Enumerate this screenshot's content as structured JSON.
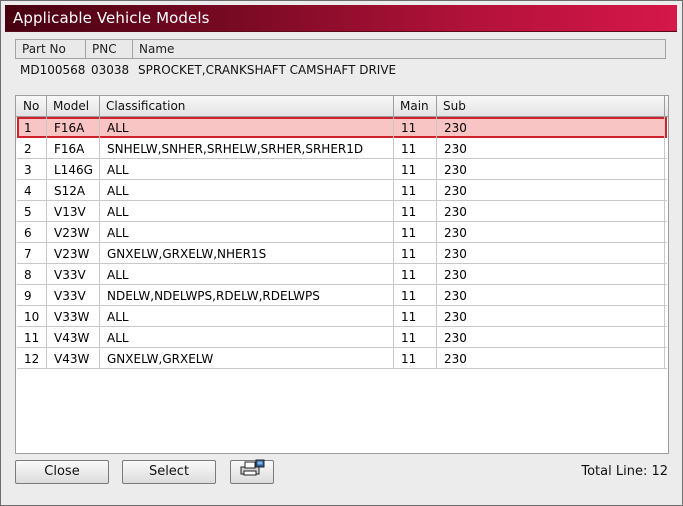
{
  "window": {
    "title": "Applicable Vehicle Models"
  },
  "part_info": {
    "headers": {
      "part_no": "Part No",
      "pnc": "PNC",
      "name": "Name"
    },
    "values": {
      "part_no": "MD100568",
      "pnc": "03038",
      "name": "SPROCKET,CRANKSHAFT CAMSHAFT DRIVE"
    }
  },
  "table": {
    "headers": {
      "no": "No",
      "model": "Model",
      "classification": "Classification",
      "main": "Main",
      "sub": "Sub"
    },
    "rows": [
      {
        "no": "1",
        "model": "F16A",
        "classification": "ALL",
        "main": "11",
        "sub": "230"
      },
      {
        "no": "2",
        "model": "F16A",
        "classification": "SNHELW,SNHER,SRHELW,SRHER,SRHER1D",
        "main": "11",
        "sub": "230"
      },
      {
        "no": "3",
        "model": "L146G",
        "classification": "ALL",
        "main": "11",
        "sub": "230"
      },
      {
        "no": "4",
        "model": "S12A",
        "classification": "ALL",
        "main": "11",
        "sub": "230"
      },
      {
        "no": "5",
        "model": "V13V",
        "classification": "ALL",
        "main": "11",
        "sub": "230"
      },
      {
        "no": "6",
        "model": "V23W",
        "classification": "ALL",
        "main": "11",
        "sub": "230"
      },
      {
        "no": "7",
        "model": "V23W",
        "classification": "GNXELW,GRXELW,NHER1S",
        "main": "11",
        "sub": "230"
      },
      {
        "no": "8",
        "model": "V33V",
        "classification": "ALL",
        "main": "11",
        "sub": "230"
      },
      {
        "no": "9",
        "model": "V33V",
        "classification": "NDELW,NDELWPS,RDELW,RDELWPS",
        "main": "11",
        "sub": "230"
      },
      {
        "no": "10",
        "model": "V33W",
        "classification": "ALL",
        "main": "11",
        "sub": "230"
      },
      {
        "no": "11",
        "model": "V43W",
        "classification": "ALL",
        "main": "11",
        "sub": "230"
      },
      {
        "no": "12",
        "model": "V43W",
        "classification": "GNXELW,GRXELW",
        "main": "11",
        "sub": "230"
      }
    ],
    "selected_row": "1"
  },
  "footer": {
    "close_label": "Close",
    "select_label": "Select",
    "print_icon": "printer-icon",
    "total_line": "Total Line: 12"
  },
  "colors": {
    "title_gradient_end": "#d6174a",
    "selection_fill": "#f9c4c4",
    "selection_border": "#d0222a"
  }
}
